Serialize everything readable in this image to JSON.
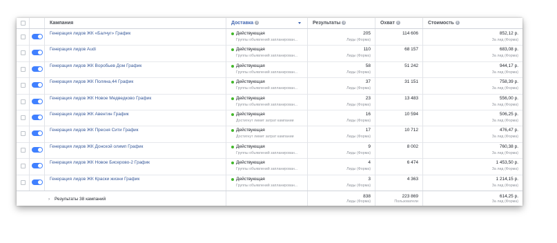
{
  "header": {
    "campaign": "Кампания",
    "delivery": "Доставка",
    "results": "Результаты",
    "reach": "Охват",
    "cost": "Стоимость"
  },
  "rows": [
    {
      "name": "Генерация лидов ЖК «Балчуг» График",
      "status": "Действующая",
      "status_sub": "Группы объявлений запланирован...",
      "results": "205",
      "results_sub": "Лиды (Форма)",
      "reach": "114 606",
      "cost": "852,12 р.",
      "cost_sub": "За лид (Форма)"
    },
    {
      "name": "Генерация лидов Audi",
      "status": "Действующая",
      "status_sub": "Группы объявлений запланирован...",
      "results": "110",
      "results_sub": "Лиды (Форма)",
      "reach": "68 157",
      "cost": "683,08 р.",
      "cost_sub": "За лид (Форма)"
    },
    {
      "name": "Генерация лидов ЖК Воробьев Дом График",
      "status": "Действующая",
      "status_sub": "Группы объявлений запланирован...",
      "results": "58",
      "results_sub": "Лиды (Форма)",
      "reach": "51 242",
      "cost": "944,17 р.",
      "cost_sub": "За лид (Форма)"
    },
    {
      "name": "Генерация лидов ЖК Поляна,44 График",
      "status": "Действующая",
      "status_sub": "Группы объявлений запланирован...",
      "results": "37",
      "results_sub": "Лиды (Форма)",
      "reach": "31 151",
      "cost": "758,39 р.",
      "cost_sub": "За лид (Форма)"
    },
    {
      "name": "Генерация лидов ЖК Новое Медведково График",
      "status": "Действующая",
      "status_sub": "Группы объявлений запланирован...",
      "results": "23",
      "results_sub": "Лиды (Форма)",
      "reach": "13 483",
      "cost": "556,00 р.",
      "cost_sub": "За лид (Форма)"
    },
    {
      "name": "Генерация лидов ЖК Авентин График",
      "status": "Действующая",
      "status_sub": "Достигнут лимит затрат кампании",
      "results": "16",
      "results_sub": "Лиды (Форма)",
      "reach": "10 594",
      "cost": "506,25 р.",
      "cost_sub": "За лид (Форма)"
    },
    {
      "name": "Генерация лидов ЖК Пресня Сити График",
      "status": "Действующая",
      "status_sub": "Достигнут лимит затрат кампании",
      "results": "17",
      "results_sub": "Лиды (Форма)",
      "reach": "10 712",
      "cost": "476,47 р.",
      "cost_sub": "За лид (Форма)"
    },
    {
      "name": "Генерация лидов ЖК Донской олимп График",
      "status": "Действующая",
      "status_sub": "Группы объявлений запланирован...",
      "results": "9",
      "results_sub": "Лиды (Форма)",
      "reach": "8 002",
      "cost": "760,38 р.",
      "cost_sub": "За лид (Форма)"
    },
    {
      "name": "Генерация лидов ЖК Новое Бисерово-2 График",
      "status": "Действующая",
      "status_sub": "Группы объявлений запланирован...",
      "results": "4",
      "results_sub": "Лиды (Форма)",
      "reach": "6 474",
      "cost": "1 453,50 р.",
      "cost_sub": "За лид (Форма)"
    },
    {
      "name": "Генерация лидов ЖК Краски жизни График",
      "status": "Действующая",
      "status_sub": "Группы объявлений запланирован...",
      "results": "3",
      "results_sub": "Лиды (Форма)",
      "reach": "4 363",
      "cost": "1 214,15 р.",
      "cost_sub": "За лид (Форма)"
    }
  ],
  "totals": {
    "label": "Результаты 38 кампаний",
    "results": "838",
    "results_sub": "Лиды (Форма)",
    "reach": "223 869",
    "reach_sub": "Пользователи",
    "cost": "614,25 р.",
    "cost_sub": "За лид (Форма)"
  },
  "colors": {
    "toggle_on": "#4080ff",
    "status_active": "#42b72a",
    "link": "#365899"
  }
}
